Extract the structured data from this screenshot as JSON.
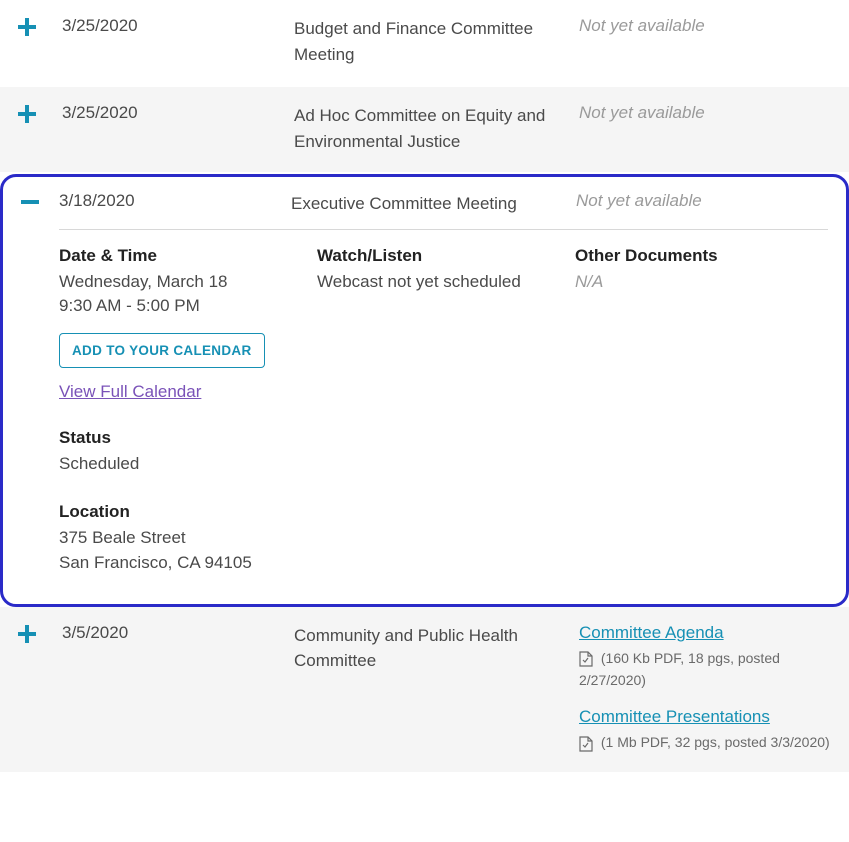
{
  "rows": [
    {
      "date": "3/25/2020",
      "title": "Budget and Finance Committee Meeting",
      "agenda_na": "Not yet available"
    },
    {
      "date": "3/25/2020",
      "title": "Ad Hoc Committee on Equity and Environmental Justice",
      "agenda_na": "Not yet available"
    },
    {
      "date": "3/5/2020",
      "title": "Community and Public Health Committee"
    }
  ],
  "expanded": {
    "date": "3/18/2020",
    "title": "Executive Committee Meeting",
    "agenda_na": "Not yet available",
    "headings": {
      "datetime": "Date & Time",
      "watch": "Watch/Listen",
      "other": "Other Documents",
      "status": "Status",
      "location": "Location"
    },
    "datetime_line1": "Wednesday, March 18",
    "datetime_line2": "9:30 AM - 5:00 PM",
    "add_cal_label": "ADD TO YOUR CALENDAR",
    "view_full_cal": "View Full Calendar",
    "watch_text": "Webcast not yet scheduled",
    "other_text": "N/A",
    "status_text": "Scheduled",
    "location_line1": "375 Beale Street",
    "location_line2": "San Francisco, CA 94105"
  },
  "docs": {
    "agenda_label": "Committee Agenda",
    "agenda_meta": "(160 Kb PDF, 18 pgs, posted 2/27/2020)",
    "pres_label": "Committee Presentations",
    "pres_meta": "(1 Mb PDF, 32 pgs, posted 3/3/2020)"
  }
}
